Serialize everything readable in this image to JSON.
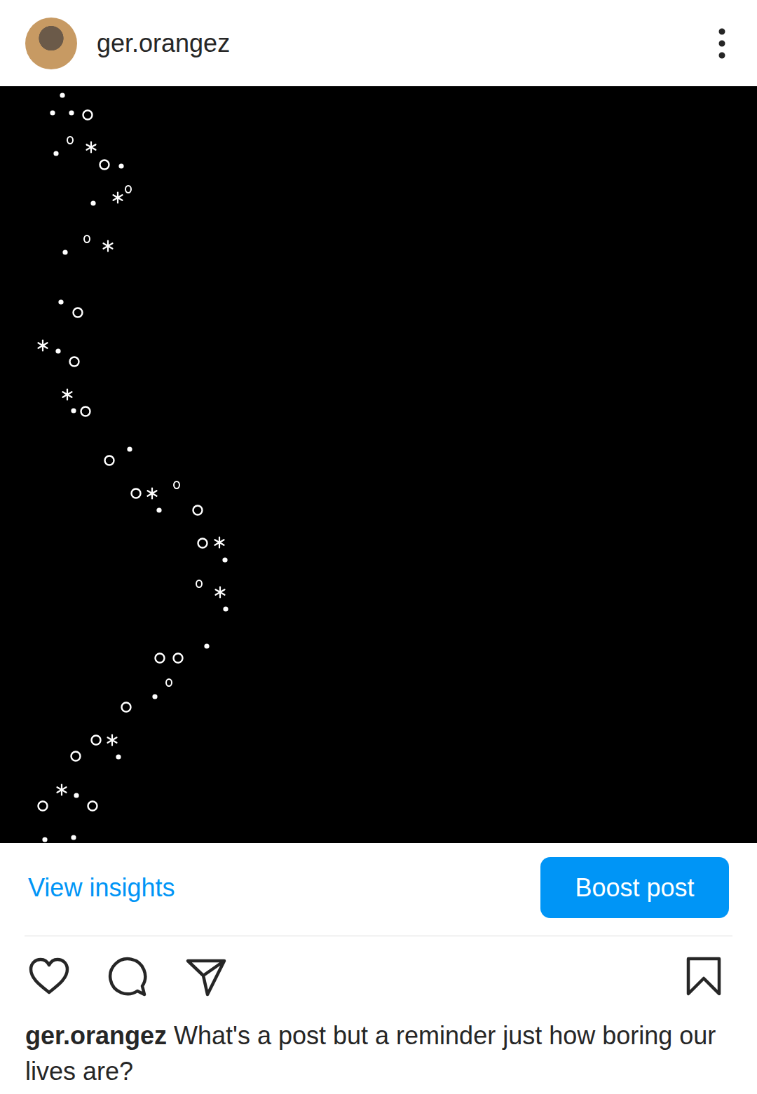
{
  "header": {
    "username": "ger.orangez"
  },
  "actions": {
    "insights": "View insights",
    "boost": "Boost post",
    "liked": false,
    "saved": false
  },
  "caption": {
    "username": "ger.orangez",
    "text": "What's a post but a reminder just how boring our lives are?"
  }
}
